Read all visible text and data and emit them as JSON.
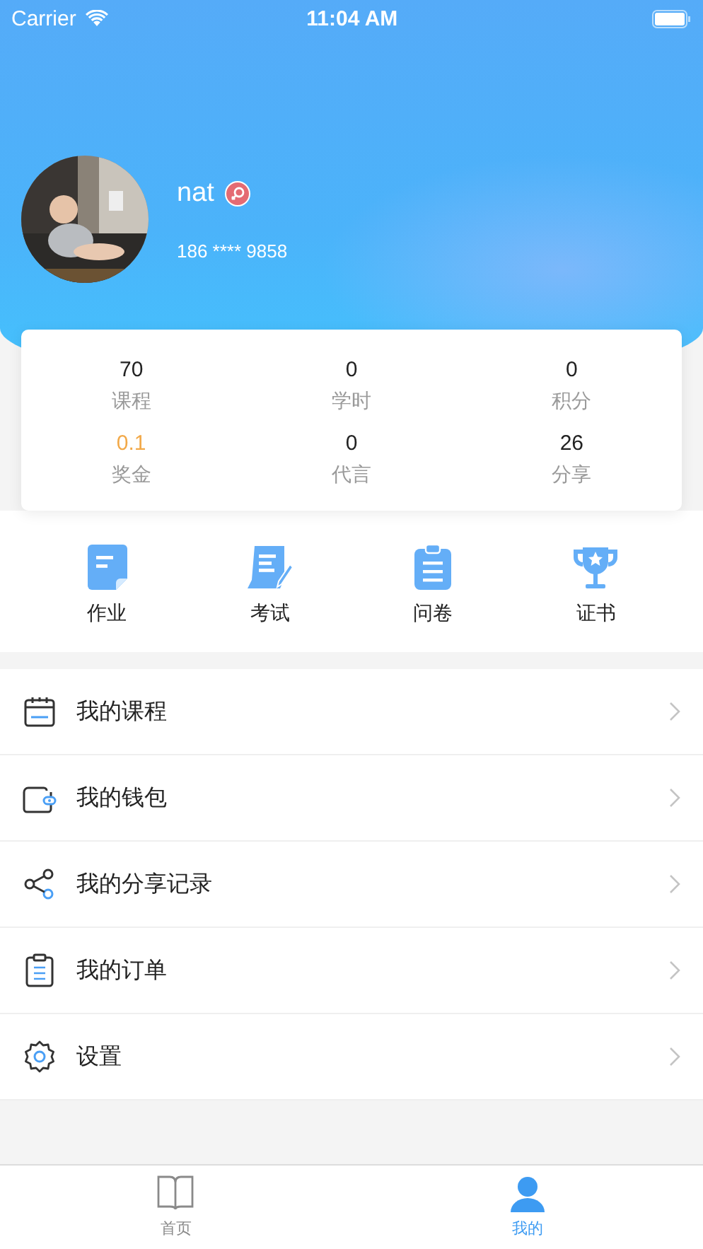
{
  "status_bar": {
    "carrier": "Carrier",
    "time": "11:04 AM"
  },
  "profile": {
    "name": "nat",
    "phone": "186 **** 9858"
  },
  "stats": [
    {
      "value": "70",
      "label": "课程",
      "highlight": false
    },
    {
      "value": "0",
      "label": "学时",
      "highlight": false
    },
    {
      "value": "0",
      "label": "积分",
      "highlight": false
    },
    {
      "value": "0.1",
      "label": "奖金",
      "highlight": true
    },
    {
      "value": "0",
      "label": "代言",
      "highlight": false
    },
    {
      "value": "26",
      "label": "分享",
      "highlight": false
    }
  ],
  "shortcuts": [
    {
      "kind": "homework",
      "label": "作业"
    },
    {
      "kind": "exam",
      "label": "考试"
    },
    {
      "kind": "survey",
      "label": "问卷"
    },
    {
      "kind": "certificate",
      "label": "证书"
    }
  ],
  "menu": [
    {
      "kind": "courses",
      "label": "我的课程"
    },
    {
      "kind": "wallet",
      "label": "我的钱包"
    },
    {
      "kind": "share",
      "label": "我的分享记录"
    },
    {
      "kind": "orders",
      "label": "我的订单"
    },
    {
      "kind": "settings",
      "label": "设置"
    }
  ],
  "tab_bar": [
    {
      "kind": "home",
      "label": "首页",
      "selected": false
    },
    {
      "kind": "me",
      "label": "我的",
      "selected": true
    }
  ]
}
